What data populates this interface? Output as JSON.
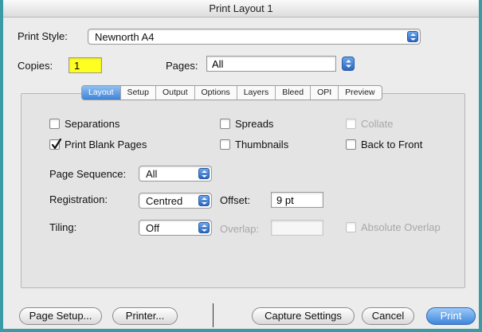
{
  "window": {
    "title": "Print Layout 1"
  },
  "print_style": {
    "label": "Print Style:",
    "value": "Newnorth A4"
  },
  "copies": {
    "label": "Copies:",
    "value": "1"
  },
  "pages": {
    "label": "Pages:",
    "value": "All"
  },
  "tabs": [
    {
      "label": "Layout",
      "active": true
    },
    {
      "label": "Setup"
    },
    {
      "label": "Output"
    },
    {
      "label": "Options"
    },
    {
      "label": "Layers"
    },
    {
      "label": "Bleed"
    },
    {
      "label": "OPI"
    },
    {
      "label": "Preview"
    }
  ],
  "checkboxes": {
    "separations": {
      "label": "Separations",
      "checked": false
    },
    "print_blank_pages": {
      "label": "Print Blank Pages",
      "checked": true
    },
    "spreads": {
      "label": "Spreads",
      "checked": false
    },
    "thumbnails": {
      "label": "Thumbnails",
      "checked": false
    },
    "collate": {
      "label": "Collate",
      "checked": false,
      "disabled": true
    },
    "back_to_front": {
      "label": "Back to Front",
      "checked": false
    },
    "absolute_overlap": {
      "label": "Absolute Overlap",
      "checked": false,
      "disabled": true
    }
  },
  "page_sequence": {
    "label": "Page Sequence:",
    "value": "All"
  },
  "registration": {
    "label": "Registration:",
    "value": "Centred"
  },
  "offset": {
    "label": "Offset:",
    "value": "9 pt"
  },
  "tiling": {
    "label": "Tiling:",
    "value": "Off"
  },
  "overlap": {
    "label": "Overlap:",
    "value": ""
  },
  "buttons": {
    "page_setup": "Page Setup...",
    "printer": "Printer...",
    "capture_settings": "Capture Settings",
    "cancel": "Cancel",
    "print": "Print"
  },
  "colors": {
    "accent": "#3f83d8",
    "frame": "#3a9aa6",
    "copies_highlight": "#ffff22"
  }
}
